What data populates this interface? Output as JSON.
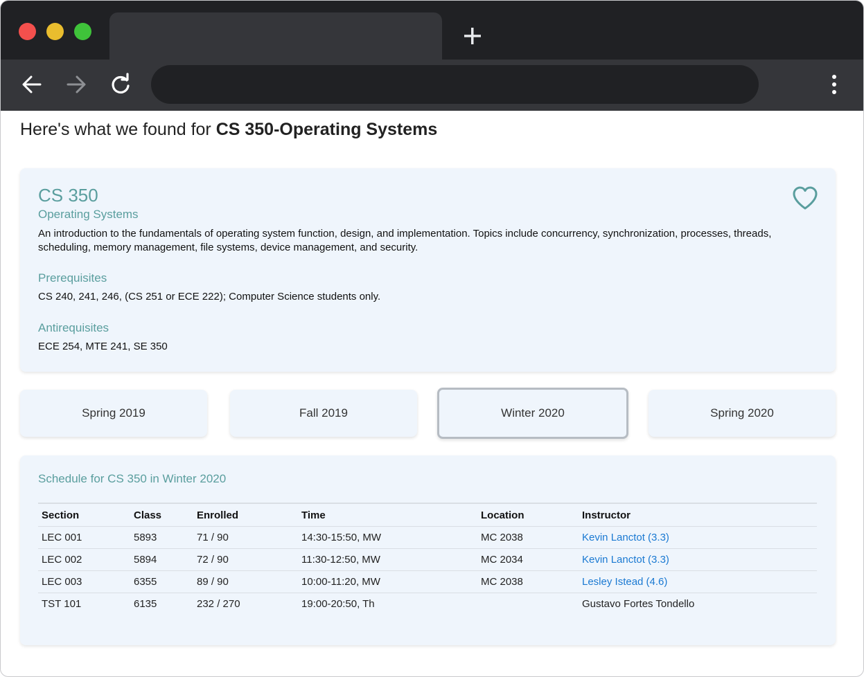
{
  "browser": {
    "window_controls": [
      "close",
      "minimize",
      "maximize"
    ],
    "new_tab_label": "+",
    "icons": {
      "back": "arrow-left-icon",
      "forward": "arrow-right-icon",
      "reload": "reload-icon",
      "menu": "kebab-menu-icon"
    }
  },
  "page": {
    "heading_prefix": "Here's what we found for ",
    "heading_query": "CS 350-Operating Systems"
  },
  "course": {
    "code": "CS 350",
    "name": "Operating Systems",
    "description": "An introduction to the fundamentals of operating system function, design, and implementation. Topics include concurrency, synchronization, processes, threads, scheduling, memory management, file systems, device management, and security.",
    "prerequisites_title": "Prerequisites",
    "prerequisites": "CS 240, 241, 246, (CS 251 or ECE 222); Computer Science students only.",
    "antirequisites_title": "Antirequisites",
    "antirequisites": "ECE 254, MTE 241, SE 350",
    "favorite_icon": "heart-outline-icon"
  },
  "terms": [
    {
      "label": "Spring 2019",
      "selected": false
    },
    {
      "label": "Fall 2019",
      "selected": false
    },
    {
      "label": "Winter 2020",
      "selected": true
    },
    {
      "label": "Spring 2020",
      "selected": false
    }
  ],
  "schedule": {
    "title": "Schedule for CS 350 in Winter 2020",
    "columns": [
      "Section",
      "Class",
      "Enrolled",
      "Time",
      "Location",
      "Instructor"
    ],
    "rows": [
      {
        "section": "LEC 001",
        "class": "5893",
        "enrolled": "71 / 90",
        "time": "14:30-15:50, MW",
        "location": "MC 2038",
        "instructor": "Kevin Lanctot (3.3)",
        "instructor_link": true
      },
      {
        "section": "LEC 002",
        "class": "5894",
        "enrolled": "72 / 90",
        "time": "11:30-12:50, MW",
        "location": "MC 2034",
        "instructor": "Kevin Lanctot (3.3)",
        "instructor_link": true
      },
      {
        "section": "LEC 003",
        "class": "6355",
        "enrolled": "89 / 90",
        "time": "10:00-11:20, MW",
        "location": "MC 2038",
        "instructor": "Lesley Istead (4.6)",
        "instructor_link": true
      },
      {
        "section": "TST 101",
        "class": "6135",
        "enrolled": "232 / 270",
        "time": "19:00-20:50, Th",
        "location": "",
        "instructor": "Gustavo Fortes Tondello",
        "instructor_link": false
      }
    ]
  },
  "colors": {
    "accent": "#5a9e9e",
    "card_bg": "#eff5fc",
    "link": "#1a79d2",
    "chrome_dark": "#202124",
    "chrome_toolbar": "#35363a"
  }
}
